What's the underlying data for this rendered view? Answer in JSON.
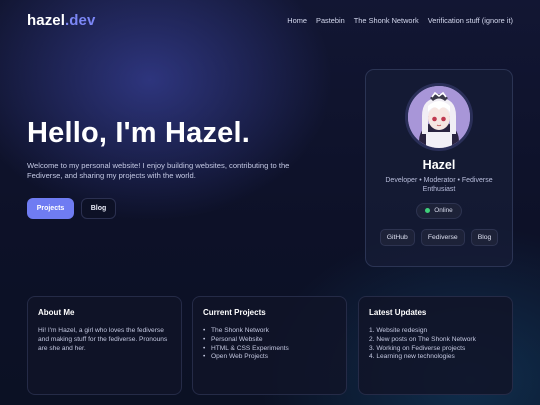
{
  "nav": {
    "logo_main": "hazel",
    "logo_accent": ".dev",
    "links": [
      "Home",
      "Pastebin",
      "The Shonk Network",
      "Verification stuff (ignore it)"
    ]
  },
  "hero": {
    "title": "Hello, I'm Hazel.",
    "subtitle": "Welcome to my personal website! I enjoy building websites, contributing to the Fediverse, and sharing my projects with the world.",
    "primary_button": "Projects",
    "secondary_button": "Blog"
  },
  "profile": {
    "name": "Hazel",
    "tagline": "Developer • Moderator • Fediverse Enthusiast",
    "status": "Online",
    "links": [
      "GitHub",
      "Fediverse",
      "Blog"
    ]
  },
  "cards": {
    "about": {
      "title": "About Me",
      "body": "Hi! I'm Hazel, a girl who loves the fediverse and making stuff for the fediverse. Pronouns are she and her."
    },
    "projects": {
      "title": "Current Projects",
      "items": [
        "The Shonk Network",
        "Personal Website",
        "HTML & CSS Experiments",
        "Open Web Projects"
      ]
    },
    "updates": {
      "title": "Latest Updates",
      "items": [
        "1. Website redesign",
        "2. New posts on The Shonk Network",
        "3. Working on Fediverse projects",
        "4. Learning new technologies"
      ]
    }
  },
  "colors": {
    "accent": "#6f7cf2",
    "status_online": "#3fd07a",
    "background": "#0d1128"
  }
}
